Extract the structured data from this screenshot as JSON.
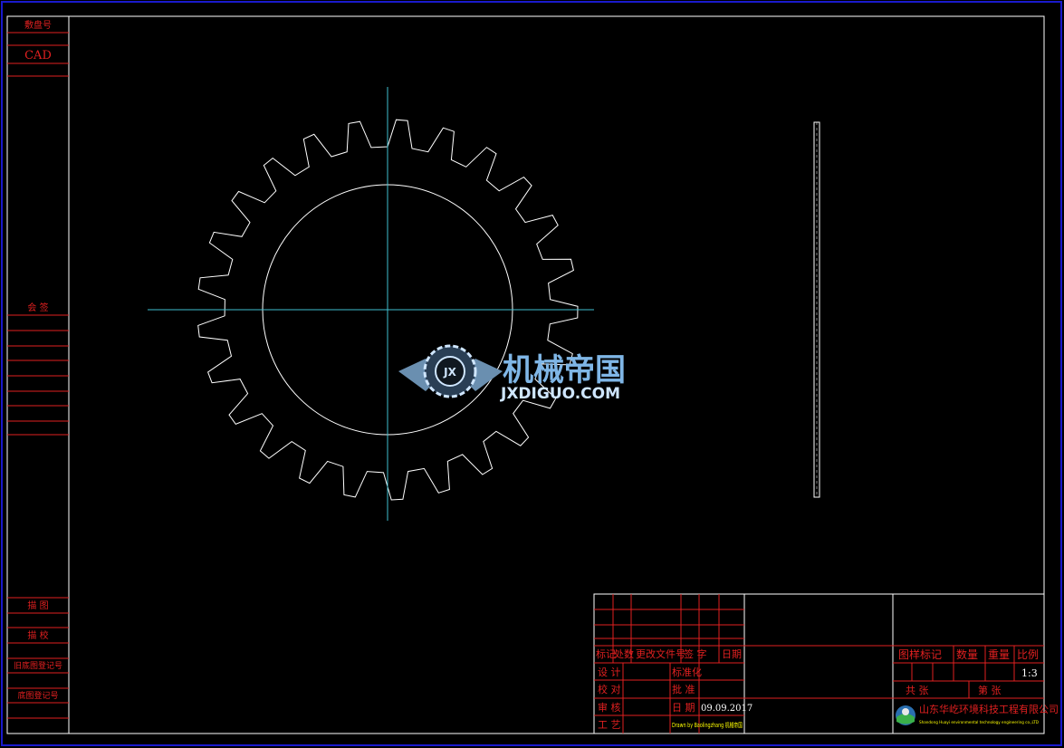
{
  "colors": {
    "background": "#000000",
    "outer_frame": "#1a1acc",
    "inner_frame": "#ffffff",
    "table_lines": "#e02020",
    "center_lines": "#40c0d0",
    "geometry": "#ffffff",
    "highlight": "#ffff00"
  },
  "left_strip": {
    "top_label": "敷盘号",
    "cad_label": "CAD",
    "mid_label": "会 签",
    "draw_label": "描 图",
    "check_label": "描 校",
    "old_reg_label": "旧底图登记号",
    "base_reg_label": "底图登记号"
  },
  "gear": {
    "teeth": 25,
    "icon": "gear-drawing"
  },
  "watermark": {
    "chinese": "机械帝国",
    "english": "JXDIGUO.COM",
    "icon": "gear-wings-logo",
    "badge": "JX"
  },
  "title_block": {
    "change_headers": {
      "mark": "标记",
      "count": "处数",
      "doc_no": "更改文件号",
      "sign": "签 字",
      "date": "日期"
    },
    "design": "设 计",
    "standardize": "标准化",
    "proofread": "校 对",
    "approve": "批 准",
    "review": "审 核",
    "date_label": "日 期",
    "date_value": "09.09.2017",
    "process": "工 艺",
    "yellow_note": "Drawn by Baolingzhang 机械帝国",
    "stage_mark": "图样标记",
    "quantity": "数量",
    "weight": "重量",
    "scale": "比例",
    "scale_value": "1:3",
    "total_sheets": "共 张",
    "sheet_no": "第 张",
    "company_cn": "山东华屹环境科技工程有限公司",
    "company_en": "Shandong Huayi environmental technology engineering co.,LTD",
    "company_icon": "globe-logo-icon"
  }
}
